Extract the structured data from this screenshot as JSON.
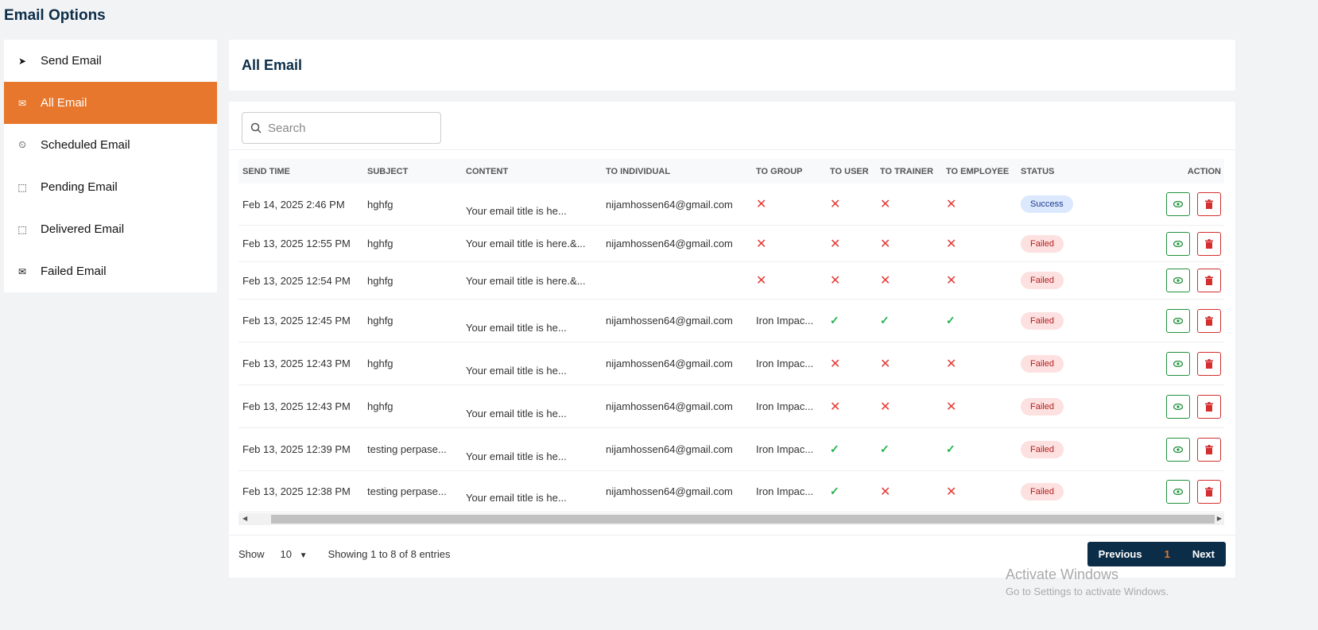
{
  "page_title": "Email Options",
  "sidebar": {
    "items": [
      {
        "label": "Send Email",
        "icon": "send-icon",
        "glyph": "➤"
      },
      {
        "label": "All Email",
        "icon": "envelope-icon",
        "glyph": "✉",
        "active": true
      },
      {
        "label": "Scheduled Email",
        "icon": "scheduled-icon",
        "glyph": "⏲"
      },
      {
        "label": "Pending Email",
        "icon": "pending-icon",
        "glyph": "⬚"
      },
      {
        "label": "Delivered Email",
        "icon": "delivered-icon",
        "glyph": "⬚"
      },
      {
        "label": "Failed Email",
        "icon": "failed-email-icon",
        "glyph": "✉"
      }
    ]
  },
  "header": {
    "title": "All Email"
  },
  "search": {
    "placeholder": "Search"
  },
  "table": {
    "columns": [
      "SEND TIME",
      "SUBJECT",
      "CONTENT",
      "TO INDIVIDUAL",
      "TO GROUP",
      "TO USER",
      "TO TRAINER",
      "TO EMPLOYEE",
      "STATUS",
      "ACTION"
    ],
    "rows": [
      {
        "time": "Feb 14, 2025 2:46 PM",
        "subject": "hghfg",
        "content": "Your email title is he...",
        "individual": "nijamhossen64@gmail.com",
        "group": "x",
        "user": "x",
        "trainer": "x",
        "employee": "x",
        "status": "Success"
      },
      {
        "time": "Feb 13, 2025 12:55 PM",
        "subject": "hghfg",
        "content": "Your email title is here.&...",
        "individual": "nijamhossen64@gmail.com",
        "group": "x",
        "user": "x",
        "trainer": "x",
        "employee": "x",
        "status": "Failed"
      },
      {
        "time": "Feb 13, 2025 12:54 PM",
        "subject": "hghfg",
        "content": "Your email title is here.&...",
        "individual": "",
        "group": "x",
        "user": "x",
        "trainer": "x",
        "employee": "x",
        "status": "Failed"
      },
      {
        "time": "Feb 13, 2025 12:45 PM",
        "subject": "hghfg",
        "content": "Your email title is he...",
        "individual": "nijamhossen64@gmail.com",
        "group": "Iron Impac...",
        "user": "check",
        "trainer": "check",
        "employee": "check",
        "status": "Failed"
      },
      {
        "time": "Feb 13, 2025 12:43 PM",
        "subject": "hghfg",
        "content": "Your email title is he...",
        "individual": "nijamhossen64@gmail.com",
        "group": "Iron Impac...",
        "user": "x",
        "trainer": "x",
        "employee": "x",
        "status": "Failed"
      },
      {
        "time": "Feb 13, 2025 12:43 PM",
        "subject": "hghfg",
        "content": "Your email title is he...",
        "individual": "nijamhossen64@gmail.com",
        "group": "Iron Impac...",
        "user": "x",
        "trainer": "x",
        "employee": "x",
        "status": "Failed"
      },
      {
        "time": "Feb 13, 2025 12:39 PM",
        "subject": "testing perpase...",
        "content": "Your email title is he...",
        "individual": "nijamhossen64@gmail.com",
        "group": "Iron Impac...",
        "user": "check",
        "trainer": "check",
        "employee": "check",
        "status": "Failed"
      },
      {
        "time": "Feb 13, 2025 12:38 PM",
        "subject": "testing perpase...",
        "content": "Your email title is he...",
        "individual": "nijamhossen64@gmail.com",
        "group": "Iron Impac...",
        "user": "check",
        "trainer": "x",
        "employee": "x",
        "status": "Failed"
      }
    ]
  },
  "footer": {
    "show_label": "Show",
    "page_size": "10",
    "entries_text": "Showing 1 to 8 of 8 entries",
    "previous": "Previous",
    "current_page": "1",
    "next": "Next"
  },
  "watermark": {
    "line1": "Activate Windows",
    "line2": "Go to Settings to activate Windows."
  }
}
